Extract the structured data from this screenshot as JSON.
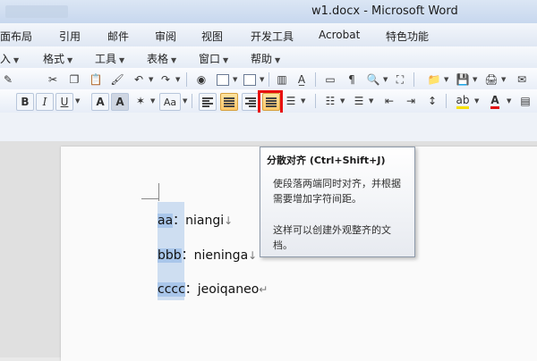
{
  "window": {
    "title": "w1.docx - Microsoft Word"
  },
  "ribbon_tabs": [
    "面布局",
    "引用",
    "邮件",
    "审阅",
    "视图",
    "开发工具",
    "Acrobat",
    "特色功能"
  ],
  "menus": [
    "入",
    "格式",
    "工具",
    "表格",
    "窗口",
    "帮助"
  ],
  "toolbar": {
    "bold": "B",
    "italic": "I",
    "underline": "U",
    "font_color_a": "A",
    "char_shading_a": "A",
    "change_case": "Aa",
    "highlight_color": "#f6e000",
    "font_color": "#e01010"
  },
  "tooltip": {
    "title": "分散对齐 (Ctrl+Shift+J)",
    "description": "使段落两端同时对齐，并根据需要增加字符间距。",
    "note": "这样可以创建外观整齐的文档。"
  },
  "document": {
    "lines": [
      {
        "selected": "aa",
        "rest": "：niangi",
        "mark": "↓"
      },
      {
        "selected": "bbb",
        "rest": "：nieninga",
        "mark": "↓"
      },
      {
        "selected": "cccc",
        "rest": "：jeoiqaneo",
        "mark": "↵"
      }
    ]
  },
  "colors": {
    "highlight_border": "#e81010",
    "selection": "#a9c6ea"
  }
}
